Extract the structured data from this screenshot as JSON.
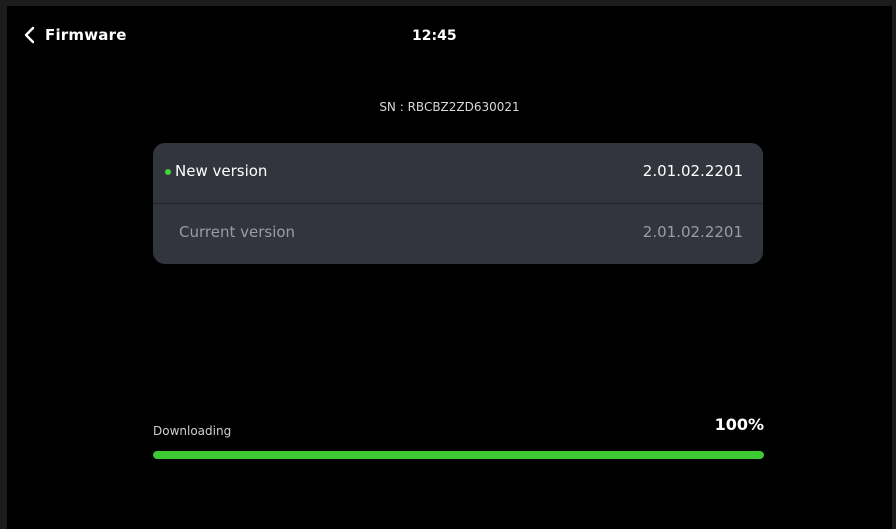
{
  "header": {
    "title": "Firmware",
    "back_icon": "chevron-left-icon",
    "time": "12:45"
  },
  "device": {
    "serial_text": "SN : RBCBZ2ZD630021"
  },
  "versions": {
    "new": {
      "label": "New version",
      "value": "2.01.02.2201",
      "indicator_color": "#3cd637"
    },
    "current": {
      "label": "Current version",
      "value": "2.01.02.2201"
    }
  },
  "download": {
    "label": "Downloading",
    "percent_text": "100%",
    "progress": 1.0,
    "bar_color": "#3cc934"
  }
}
